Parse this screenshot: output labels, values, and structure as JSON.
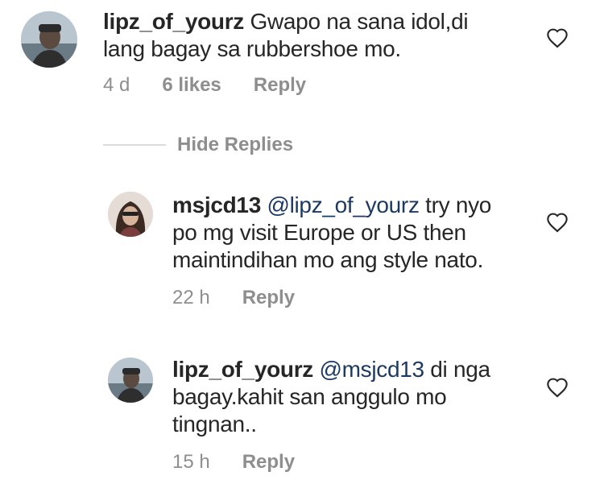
{
  "comments": [
    {
      "username": "lipz_of_yourz",
      "mention": "",
      "text_line1": " Gwapo na sana idol,di",
      "text_line2": "lang bagay sa rubbershoe mo.",
      "text_line3": "",
      "time": "4 d",
      "likes": "6 likes",
      "reply_label": "Reply",
      "heart_icon": "heart-outline-icon"
    },
    {
      "username": "msjcd13",
      "mention": "@lipz_of_yourz",
      "text_line1": " try nyo",
      "text_line2": "po mg visit Europe or US then",
      "text_line3": "maintindihan mo ang style nato.",
      "time": "22 h",
      "likes": "",
      "reply_label": "Reply",
      "heart_icon": "heart-outline-icon"
    },
    {
      "username": "lipz_of_yourz",
      "mention": "@msjcd13",
      "text_line1": " di nga",
      "text_line2": "bagay.kahit san anggulo mo",
      "text_line3": "tingnan..",
      "time": "15 h",
      "likes": "",
      "reply_label": "Reply",
      "heart_icon": "heart-outline-icon"
    }
  ],
  "hide_replies_label": "Hide Replies",
  "colors": {
    "text": "#262626",
    "meta": "#8e8e8e",
    "mention": "#1c3a63",
    "divider": "#dbdbdb"
  }
}
